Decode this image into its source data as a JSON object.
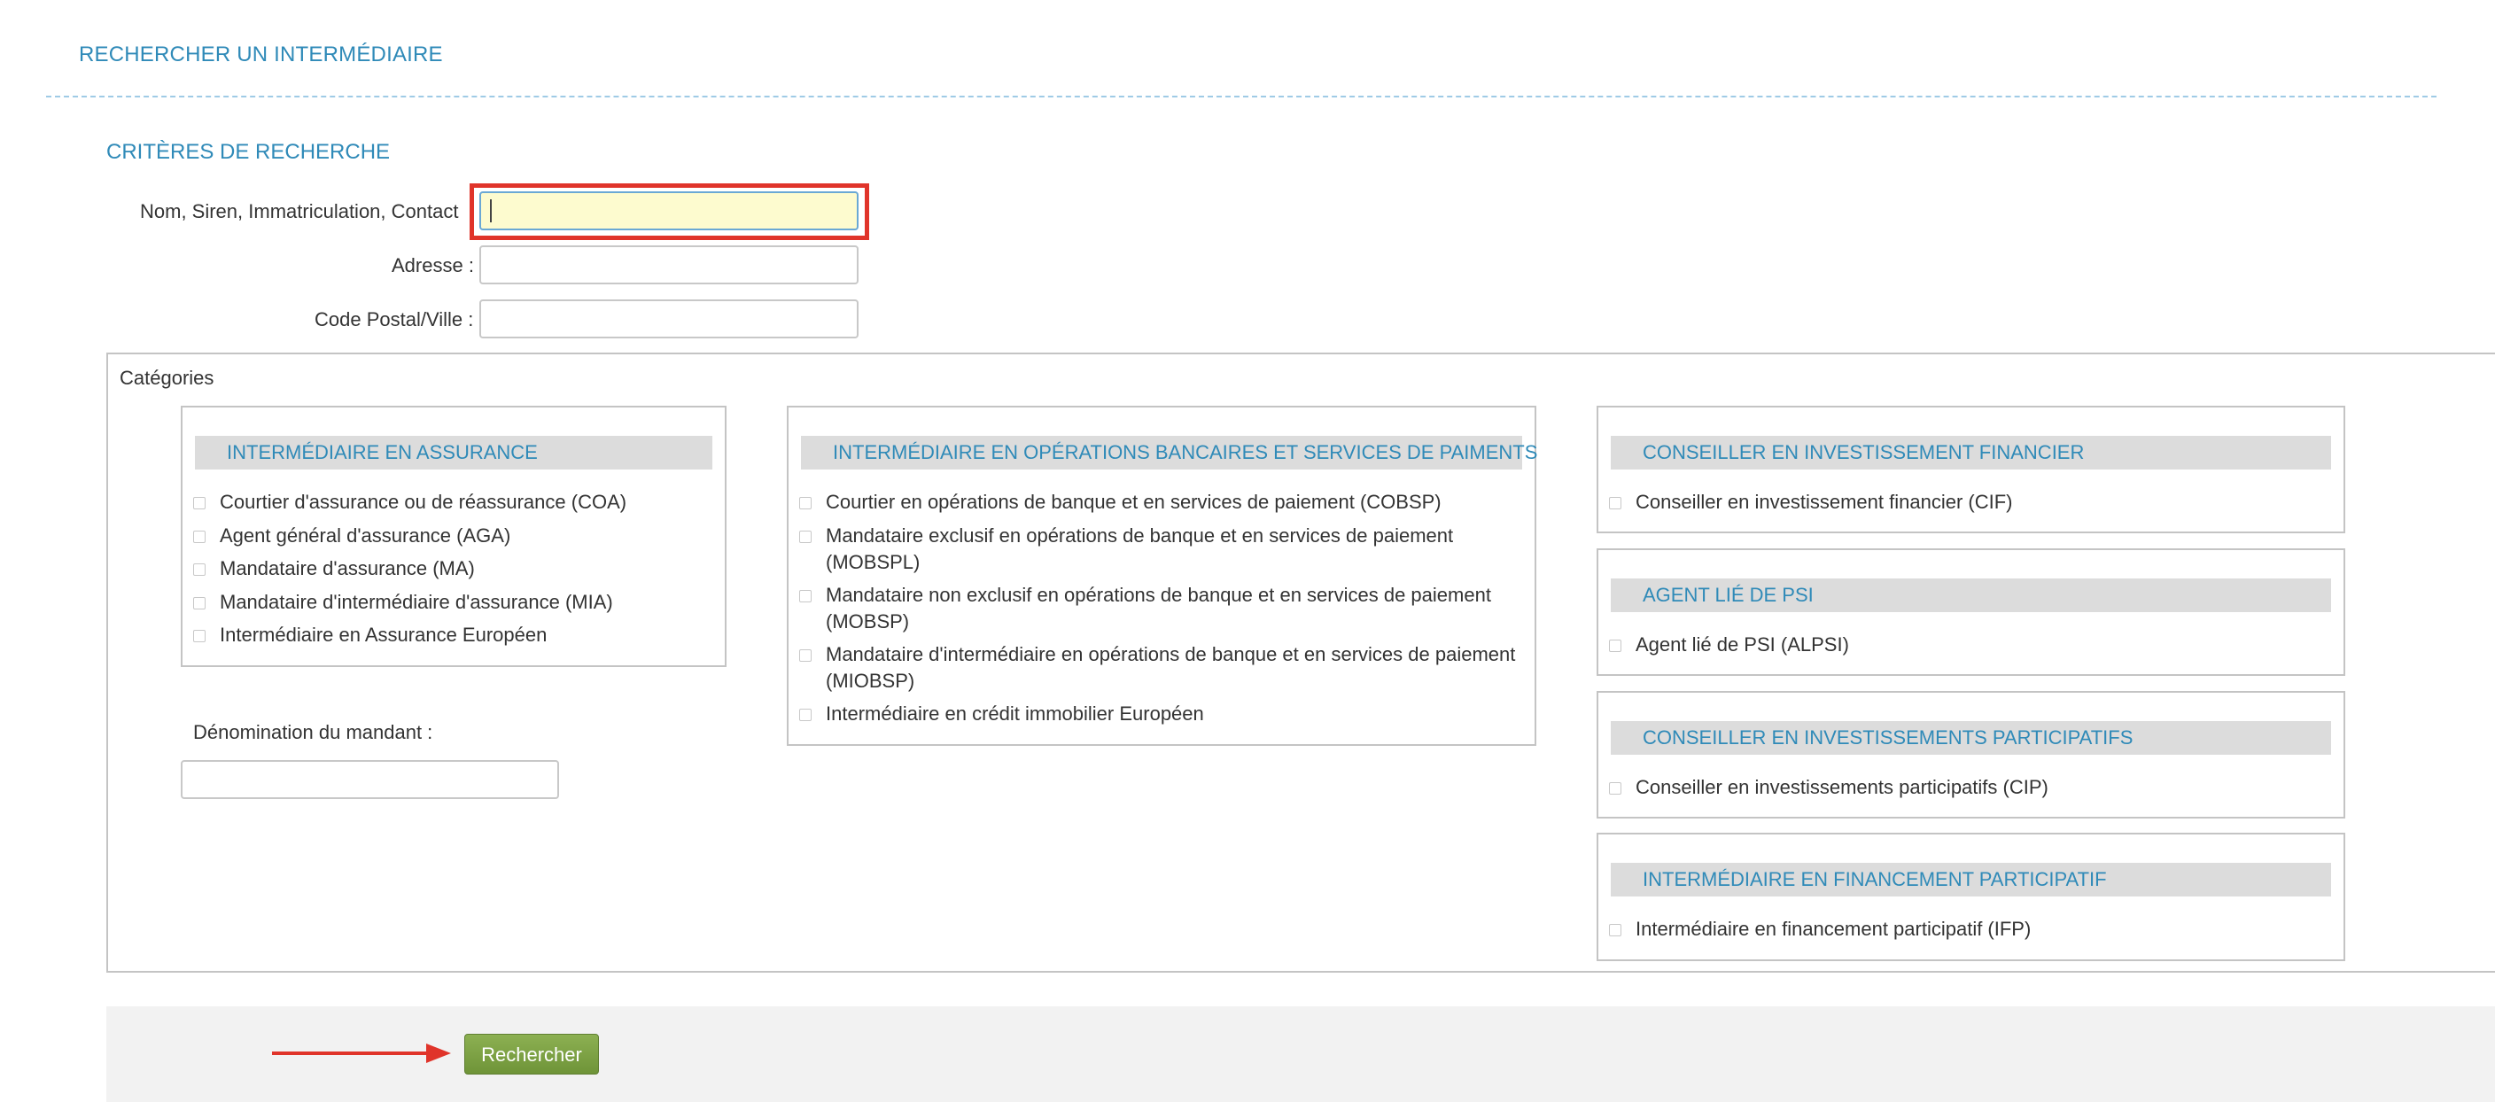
{
  "page": {
    "title": "RECHERCHER UN INTERMÉDIAIRE",
    "criteria_title": "CRITÈRES DE RECHERCHE"
  },
  "form": {
    "name_label": "Nom, Siren, Immatriculation, Contact",
    "name_value": "",
    "address_label": "Adresse :",
    "address_value": "",
    "postal_label": "Code Postal/Ville :",
    "postal_value": ""
  },
  "categories": {
    "legend": "Catégories",
    "panels": [
      {
        "title": "INTERMÉDIAIRE EN ASSURANCE",
        "items": [
          "Courtier d'assurance ou de réassurance (COA)",
          "Agent général d'assurance (AGA)",
          "Mandataire d'assurance (MA)",
          "Mandataire d'intermédiaire d'assurance (MIA)",
          "Intermédiaire en Assurance Européen"
        ]
      },
      {
        "title": "INTERMÉDIAIRE EN OPÉRATIONS BANCAIRES ET SERVICES DE PAIMENTS",
        "items": [
          "Courtier en opérations de banque et en services de paiement (COBSP)",
          "Mandataire exclusif en opérations de banque et en services de paiement (MOBSPL)",
          "Mandataire non exclusif en opérations de banque et en services de paiement (MOBSP)",
          "Mandataire d'intermédiaire en opérations de banque et en services de paiement (MIOBSP)",
          "Intermédiaire en crédit immobilier Européen"
        ]
      },
      {
        "title": "CONSEILLER EN INVESTISSEMENT FINANCIER",
        "items": [
          "Conseiller en investissement financier (CIF)"
        ]
      },
      {
        "title": "AGENT LIÉ DE PSI",
        "items": [
          "Agent lié de PSI (ALPSI)"
        ]
      },
      {
        "title": "CONSEILLER EN INVESTISSEMENTS PARTICIPATIFS",
        "items": [
          "Conseiller en investissements participatifs (CIP)"
        ]
      },
      {
        "title": "INTERMÉDIAIRE EN FINANCEMENT PARTICIPATIF",
        "items": [
          "Intermédiaire en financement participatif (IFP)"
        ]
      }
    ]
  },
  "mandant": {
    "label": "Dénomination du mandant :",
    "value": ""
  },
  "footer": {
    "search_label": "Rechercher"
  },
  "colors": {
    "accent": "#2f8ab8",
    "focus_highlight": "#e0342a",
    "button": "#7a9e3f"
  }
}
